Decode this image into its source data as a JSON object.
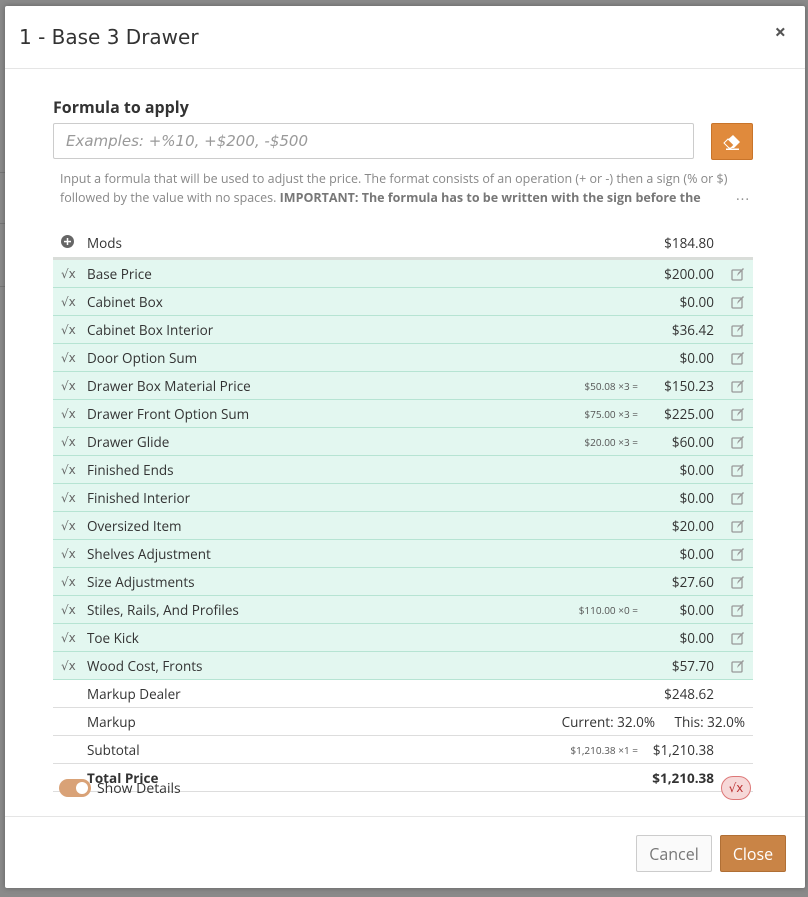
{
  "modal": {
    "title": "1 - Base 3 Drawer",
    "close_glyph": "×"
  },
  "formula": {
    "label": "Formula to apply",
    "placeholder": "Examples: +%10, +$200, -$500",
    "help_text": "Input a formula that will be used to adjust the price. The format consists of an operation (+ or -) then a sign (% or $) followed by the value with no spaces.",
    "help_important": "IMPORTANT: The formula has to be written with the sign before the",
    "more": "···"
  },
  "mods": {
    "label": "Mods",
    "value": "$184.80"
  },
  "items": [
    {
      "label": "Base Price",
      "calc": "",
      "value": "$200.00"
    },
    {
      "label": "Cabinet Box",
      "calc": "",
      "value": "$0.00"
    },
    {
      "label": "Cabinet Box Interior",
      "calc": "",
      "value": "$36.42"
    },
    {
      "label": "Door Option Sum",
      "calc": "",
      "value": "$0.00"
    },
    {
      "label": "Drawer Box Material Price",
      "calc": "$50.08 ×3 =",
      "value": "$150.23"
    },
    {
      "label": "Drawer Front Option Sum",
      "calc": "$75.00 ×3 =",
      "value": "$225.00"
    },
    {
      "label": "Drawer Glide",
      "calc": "$20.00 ×3 =",
      "value": "$60.00"
    },
    {
      "label": "Finished Ends",
      "calc": "",
      "value": "$0.00"
    },
    {
      "label": "Finished Interior",
      "calc": "",
      "value": "$0.00"
    },
    {
      "label": "Oversized Item",
      "calc": "",
      "value": "$20.00"
    },
    {
      "label": "Shelves Adjustment",
      "calc": "",
      "value": "$0.00"
    },
    {
      "label": "Size Adjustments",
      "calc": "",
      "value": "$27.60"
    },
    {
      "label": "Stiles, Rails, And Profiles",
      "calc": "$110.00 ×0 =",
      "value": "$0.00"
    },
    {
      "label": "Toe Kick",
      "calc": "",
      "value": "$0.00"
    },
    {
      "label": "Wood Cost, Fronts",
      "calc": "",
      "value": "$57.70"
    }
  ],
  "markup_dealer": {
    "label": "Markup Dealer",
    "value": "$248.62"
  },
  "markup": {
    "label": "Markup",
    "current": "Current: 32.0%",
    "this": "This: 32.0%"
  },
  "subtotal": {
    "label": "Subtotal",
    "calc": "$1,210.38 ×1 =",
    "value": "$1,210.38"
  },
  "total": {
    "label": "Total Price",
    "value": "$1,210.38"
  },
  "details": {
    "label": "Show Details",
    "enabled": true
  },
  "footer": {
    "cancel_label": "Cancel",
    "close_label": "Close"
  },
  "colors": {
    "accent": "#c98446",
    "green_row": "#e3f7f0",
    "eraser": "#e08a3c"
  }
}
